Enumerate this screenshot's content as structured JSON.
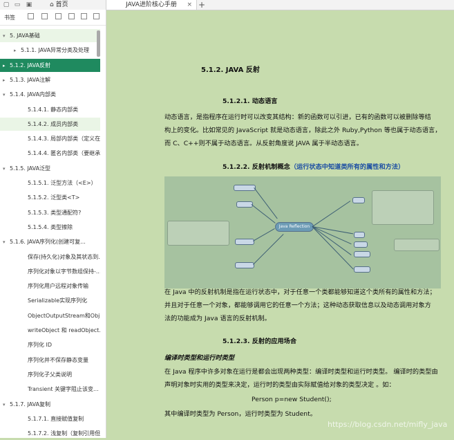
{
  "app": {
    "home_tab": "首页",
    "doc_tab": "JAVA进阶核心手册",
    "new_tab": "+",
    "close": "×"
  },
  "sidebar": {
    "title": "书签",
    "items": [
      {
        "label": "5. JAVA基础",
        "arrow": "▾",
        "state": "light"
      },
      {
        "label": "5.1.1. JAVA异常分类及处理",
        "arrow": "▸",
        "state": ""
      },
      {
        "label": "5.1.2. JAVA反射",
        "arrow": "▸",
        "state": "active"
      },
      {
        "label": "5.1.3. JAVA注解",
        "arrow": "▸",
        "state": ""
      },
      {
        "label": "5.1.4. JAVA内部类",
        "arrow": "▾",
        "state": ""
      },
      {
        "label": "5.1.4.1. 静态内部类",
        "arrow": "",
        "state": ""
      },
      {
        "label": "5.1.4.2. 成员内部类",
        "arrow": "",
        "state": "light"
      },
      {
        "label": "5.1.4.3. 局部内部类（定义在...",
        "arrow": "",
        "state": ""
      },
      {
        "label": "5.1.4.4. 匿名内部类（要继承...",
        "arrow": "",
        "state": ""
      },
      {
        "label": "5.1.5. JAVA泛型",
        "arrow": "▾",
        "state": ""
      },
      {
        "label": "5.1.5.1. 泛型方法（<E>）",
        "arrow": "",
        "state": ""
      },
      {
        "label": "5.1.5.2. 泛型类<T>",
        "arrow": "",
        "state": ""
      },
      {
        "label": "5.1.5.3. 类型通配符?",
        "arrow": "",
        "state": ""
      },
      {
        "label": "5.1.5.4. 类型擦除",
        "arrow": "",
        "state": ""
      },
      {
        "label": "5.1.6. JAVA序列化(创建可复...",
        "arrow": "▾",
        "state": ""
      },
      {
        "label": "保存(持久化)对象及其状态到...",
        "arrow": "",
        "state": ""
      },
      {
        "label": "序列化对象以字节数组保持-...",
        "arrow": "",
        "state": ""
      },
      {
        "label": "序列化用户远程对象传输",
        "arrow": "",
        "state": ""
      },
      {
        "label": "Serializable实现序列化",
        "arrow": "",
        "state": ""
      },
      {
        "label": "ObjectOutputStream和Obj...",
        "arrow": "",
        "state": ""
      },
      {
        "label": "writeObject 和 readObject...",
        "arrow": "",
        "state": ""
      },
      {
        "label": "序列化 ID",
        "arrow": "",
        "state": ""
      },
      {
        "label": "序列化并不保存静态变量",
        "arrow": "",
        "state": ""
      },
      {
        "label": "序列化子父类说明",
        "arrow": "",
        "state": ""
      },
      {
        "label": "Transient  关键字阻止该变...",
        "arrow": "",
        "state": ""
      },
      {
        "label": "5.1.7. JAVA复制",
        "arrow": "▾",
        "state": ""
      },
      {
        "label": "5.1.7.1. 直接赋值复制",
        "arrow": "",
        "state": ""
      },
      {
        "label": "5.1.7.2. 浅复制（复制引用但...",
        "arrow": "",
        "state": ""
      }
    ]
  },
  "doc": {
    "h2": "5.1.2.  JAVA 反射",
    "h3_1": "5.1.2.1.      动态语言",
    "p1": [
      "动态语言，是指程序在运行时可以改变其结构：新的函数可以引进，已有的函数可以被删除等结",
      "构上的变化。比如常见的 JavaScript 就是动态语言，除此之外 Ruby,Python 等也属于动态语言，",
      "而 C、C++则不属于动态语言。从反射角度说 JAVA 属于半动态语言。"
    ],
    "h3_2": "5.1.2.2.      反射机制概念",
    "h3_2_note": "（运行状态中知道类所有的属性和方法）",
    "mindmap_center": "Java Reflection",
    "p2": [
      "在  Java  中的反射机制是指在运行状态中，对于任意一个类都能够知道这个类所有的属性和方法；",
      "并且对于任意一个对象，都能够调用它的任意一个方法；这种动态获取信息以及动态调用对象方",
      "法的功能成为 Java 语言的反射机制。"
    ],
    "h3_3": "5.1.2.3.      反射的应用场合",
    "h4": "编译时类型和运行时类型",
    "p3": [
      "在 Java 程序中许多对象在运行是都会出现两种类型：编译时类型和运行时类型。  编译时的类型由",
      "声明对象时实用的类型来决定，运行时的类型由实际赋值给对象的类型决定  。如："
    ],
    "code": "Person p=new Student();",
    "p4": "其中编译时类型为 Person，运行时类型为 Student。",
    "watermark": "https://blog.csdn.net/mifly_java"
  }
}
